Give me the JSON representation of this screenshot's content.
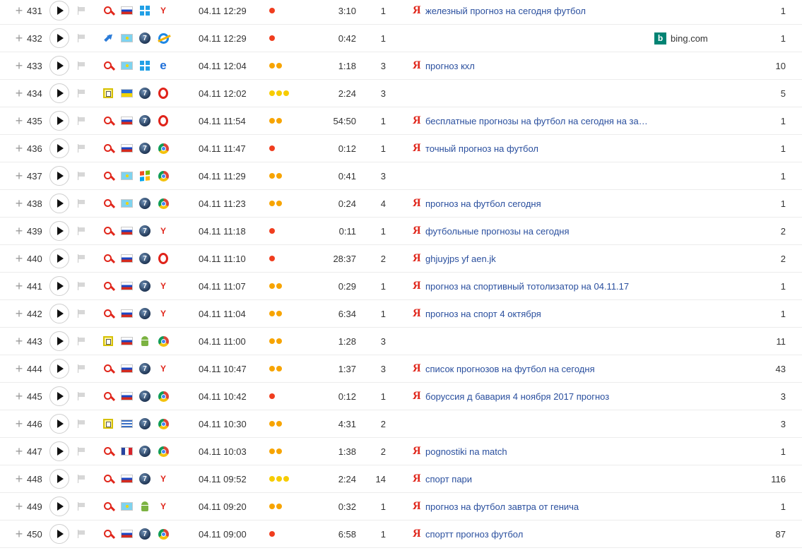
{
  "engine_icon": "Я",
  "rows": [
    {
      "num": "431",
      "source": "search",
      "country": "ru",
      "os": "win10",
      "browser": "yandex",
      "time": "04.11 12:29",
      "dots": [
        "red"
      ],
      "duration": "3:10",
      "depth": "1",
      "engine": "yandex",
      "phrase": "железный прогноз на сегодня футбол",
      "views": "1"
    },
    {
      "num": "432",
      "source": "referral",
      "country": "kz",
      "os": "win7",
      "browser": "ie",
      "time": "04.11 12:29",
      "dots": [
        "red"
      ],
      "duration": "0:42",
      "depth": "1",
      "engine": "",
      "phrase": "",
      "referrer": "bing.com",
      "views": "1"
    },
    {
      "num": "433",
      "source": "search",
      "country": "kz",
      "os": "win10",
      "browser": "edge",
      "time": "04.11 12:04",
      "dots": [
        "orange",
        "orange"
      ],
      "duration": "1:18",
      "depth": "3",
      "engine": "yandex",
      "phrase": "прогноз кхл",
      "views": "10"
    },
    {
      "num": "434",
      "source": "direct",
      "country": "ua",
      "os": "win7",
      "browser": "opera",
      "time": "04.11 12:02",
      "dots": [
        "yellow",
        "yellow",
        "yellow"
      ],
      "duration": "2:24",
      "depth": "3",
      "engine": "",
      "phrase": "",
      "views": "5"
    },
    {
      "num": "435",
      "source": "search",
      "country": "ru",
      "os": "win7",
      "browser": "opera",
      "time": "04.11 11:54",
      "dots": [
        "orange",
        "orange"
      ],
      "duration": "54:50",
      "depth": "1",
      "engine": "yandex",
      "phrase": "бесплатные прогнозы на футбол на сегодня на зав…",
      "views": "1"
    },
    {
      "num": "436",
      "source": "search",
      "country": "ru",
      "os": "win7",
      "browser": "chrome",
      "time": "04.11 11:47",
      "dots": [
        "red"
      ],
      "duration": "0:12",
      "depth": "1",
      "engine": "yandex",
      "phrase": "точный прогноз на футбол",
      "views": "1"
    },
    {
      "num": "437",
      "source": "search",
      "country": "kz",
      "os": "winxp",
      "browser": "chrome",
      "time": "04.11 11:29",
      "dots": [
        "orange",
        "orange"
      ],
      "duration": "0:41",
      "depth": "3",
      "engine": "",
      "phrase": "",
      "views": "1"
    },
    {
      "num": "438",
      "source": "search",
      "country": "kz",
      "os": "win7",
      "browser": "chrome",
      "time": "04.11 11:23",
      "dots": [
        "orange",
        "orange"
      ],
      "duration": "0:24",
      "depth": "4",
      "engine": "yandex",
      "phrase": "прогноз на футбол сегодня",
      "views": "1"
    },
    {
      "num": "439",
      "source": "search",
      "country": "ru",
      "os": "win7",
      "browser": "yandex",
      "time": "04.11 11:18",
      "dots": [
        "red"
      ],
      "duration": "0:11",
      "depth": "1",
      "engine": "yandex",
      "phrase": "футбольные прогнозы на сегодня",
      "views": "2"
    },
    {
      "num": "440",
      "source": "search",
      "country": "ru",
      "os": "win7",
      "browser": "opera",
      "time": "04.11 11:10",
      "dots": [
        "red"
      ],
      "duration": "28:37",
      "depth": "2",
      "engine": "yandex",
      "phrase": "ghjuyjps yf aen.jk",
      "views": "2"
    },
    {
      "num": "441",
      "source": "search",
      "country": "ru",
      "os": "win7",
      "browser": "yandex",
      "time": "04.11 11:07",
      "dots": [
        "orange",
        "orange"
      ],
      "duration": "0:29",
      "depth": "1",
      "engine": "yandex",
      "phrase": "прогноз на спортивный тотолизатор на 04.11.17",
      "views": "1"
    },
    {
      "num": "442",
      "source": "search",
      "country": "ru",
      "os": "win7",
      "browser": "yandex",
      "time": "04.11 11:04",
      "dots": [
        "orange",
        "orange"
      ],
      "duration": "6:34",
      "depth": "1",
      "engine": "yandex",
      "phrase": "прогноз на спорт 4 октября",
      "views": "1"
    },
    {
      "num": "443",
      "source": "direct",
      "country": "ru",
      "os": "android",
      "browser": "chrome",
      "time": "04.11 11:00",
      "dots": [
        "orange",
        "orange"
      ],
      "duration": "1:28",
      "depth": "3",
      "engine": "",
      "phrase": "",
      "views": "11"
    },
    {
      "num": "444",
      "source": "search",
      "country": "ru",
      "os": "win7",
      "browser": "yandex",
      "time": "04.11 10:47",
      "dots": [
        "orange",
        "orange"
      ],
      "duration": "1:37",
      "depth": "3",
      "engine": "yandex",
      "phrase": "список прогнозов на футбол на сегодня",
      "views": "43"
    },
    {
      "num": "445",
      "source": "search",
      "country": "ru",
      "os": "win7",
      "browser": "chrome",
      "time": "04.11 10:42",
      "dots": [
        "red"
      ],
      "duration": "0:12",
      "depth": "1",
      "engine": "yandex",
      "phrase": "боруссия д бавария 4 ноября 2017 прогноз",
      "views": "3"
    },
    {
      "num": "446",
      "source": "direct",
      "country": "gr",
      "os": "win7",
      "browser": "chrome",
      "time": "04.11 10:30",
      "dots": [
        "orange",
        "orange"
      ],
      "duration": "4:31",
      "depth": "2",
      "engine": "",
      "phrase": "",
      "views": "3"
    },
    {
      "num": "447",
      "source": "search",
      "country": "fr",
      "os": "win7",
      "browser": "chrome",
      "time": "04.11 10:03",
      "dots": [
        "orange",
        "orange"
      ],
      "duration": "1:38",
      "depth": "2",
      "engine": "yandex",
      "phrase": "pognostiki na match",
      "views": "1"
    },
    {
      "num": "448",
      "source": "search",
      "country": "ru",
      "os": "win7",
      "browser": "yandex",
      "time": "04.11 09:52",
      "dots": [
        "yellow",
        "yellow",
        "yellow"
      ],
      "duration": "2:24",
      "depth": "14",
      "engine": "yandex",
      "phrase": "спорт пари",
      "views": "116"
    },
    {
      "num": "449",
      "source": "search",
      "country": "kz",
      "os": "android",
      "browser": "yandex",
      "time": "04.11 09:20",
      "dots": [
        "orange",
        "orange"
      ],
      "duration": "0:32",
      "depth": "1",
      "engine": "yandex",
      "phrase": "прогноз на футбол завтра от генича",
      "views": "1"
    },
    {
      "num": "450",
      "source": "search",
      "country": "ru",
      "os": "win7",
      "browser": "chrome",
      "time": "04.11 09:00",
      "dots": [
        "red"
      ],
      "duration": "6:58",
      "depth": "1",
      "engine": "yandex",
      "phrase": "спортт прогноз футбол",
      "views": "87"
    }
  ]
}
